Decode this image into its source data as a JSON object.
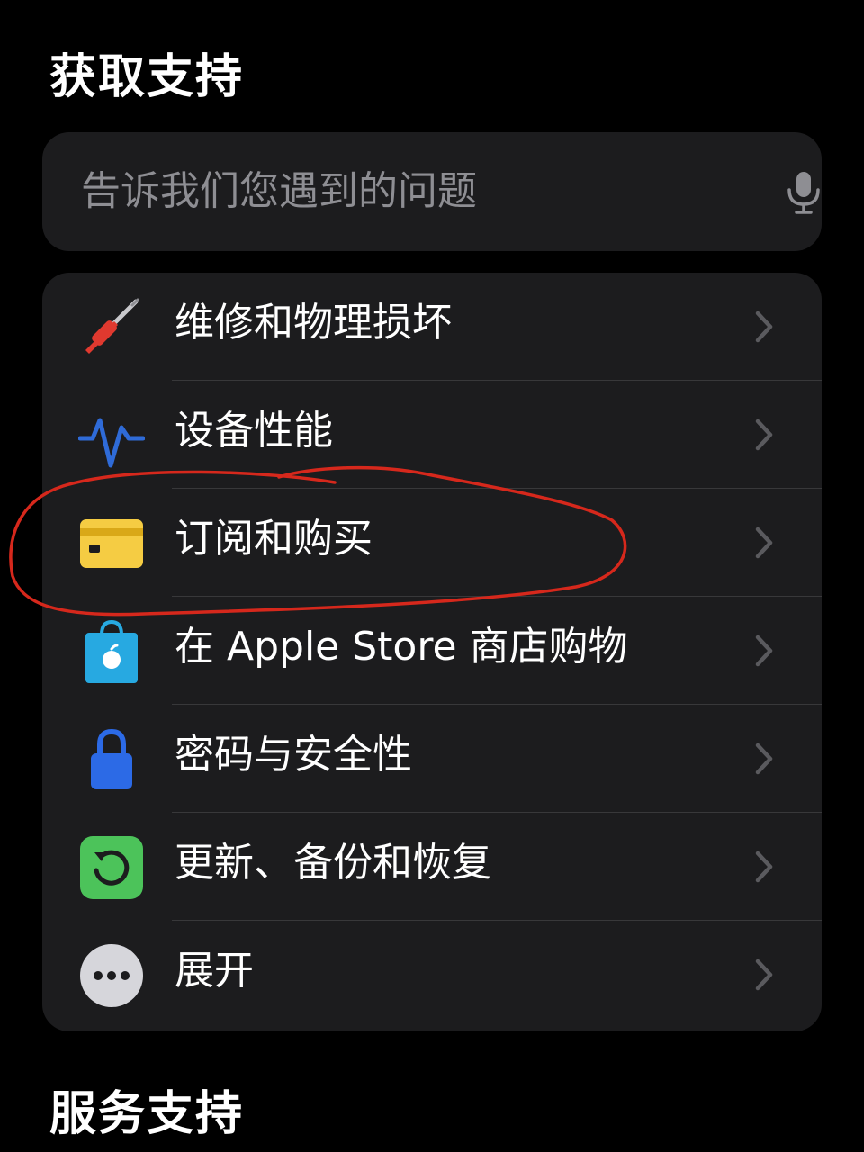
{
  "header": {
    "title": "获取支持"
  },
  "search": {
    "placeholder": "告诉我们您遇到的问题",
    "mic_icon": "microphone-icon"
  },
  "list": {
    "items": [
      {
        "label": "维修和物理损坏",
        "icon": "screwdriver-icon",
        "color": "#e0392f"
      },
      {
        "label": "设备性能",
        "icon": "heartbeat-icon",
        "color": "#2f6bd8"
      },
      {
        "label": "订阅和购买",
        "icon": "card-icon",
        "color": "#f5cc43"
      },
      {
        "label": "在 Apple Store 商店购物",
        "icon": "shopping-bag-icon",
        "color": "#27a9e1"
      },
      {
        "label": "密码与安全性",
        "icon": "lock-icon",
        "color": "#2c6ae6"
      },
      {
        "label": "更新、备份和恢复",
        "icon": "restore-icon",
        "color": "#4cc35a"
      },
      {
        "label": "展开",
        "icon": "more-icon",
        "color": "#d6d6db"
      }
    ]
  },
  "footer": {
    "title": "服务支持"
  },
  "annotation": {
    "color": "#d6281c"
  }
}
